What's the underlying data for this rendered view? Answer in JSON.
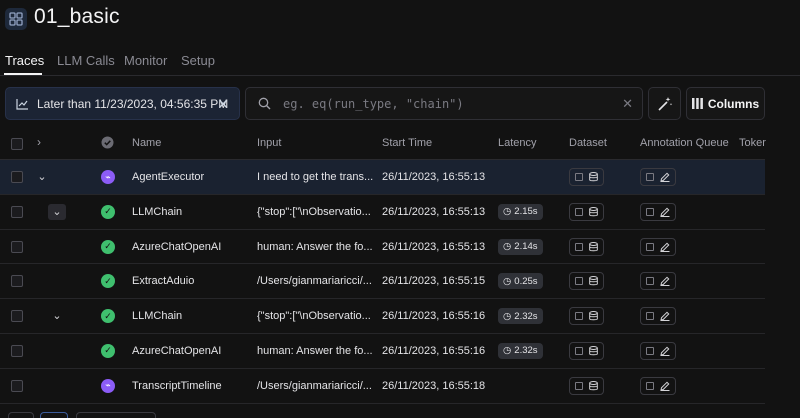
{
  "project": {
    "title": "01_basic",
    "icon": "grid-icon"
  },
  "tabs": [
    {
      "label": "Traces",
      "active": true
    },
    {
      "label": "LLM Calls",
      "active": false
    },
    {
      "label": "Monitor",
      "active": false
    },
    {
      "label": "Setup",
      "active": false
    }
  ],
  "toolbar": {
    "filter_label": "Later than 11/23/2023, 04:56:35 PM",
    "search_placeholder": "eg. eq(run_type, \"chain\")",
    "columns_label": "Columns"
  },
  "table": {
    "headers": {
      "name": "Name",
      "input": "Input",
      "start_time": "Start Time",
      "latency": "Latency",
      "dataset": "Dataset",
      "annotation_queue": "Annotation Queue",
      "tokens": "Toker"
    },
    "rows": [
      {
        "name": "AgentExecutor",
        "input": "I need to get the trans...",
        "start_time": "26/11/2023, 16:55:13",
        "latency": "",
        "status": "running",
        "selected": true
      },
      {
        "name": "LLMChain",
        "input": "{\"stop\":[\"\\nObservatio...",
        "start_time": "26/11/2023, 16:55:13",
        "latency": "2.15s",
        "status": "success",
        "selected": false
      },
      {
        "name": "AzureChatOpenAI",
        "input": "human: Answer the fo...",
        "start_time": "26/11/2023, 16:55:13",
        "latency": "2.14s",
        "status": "success",
        "selected": false
      },
      {
        "name": "ExtractAduio",
        "input": "/Users/gianmariaricci/...",
        "start_time": "26/11/2023, 16:55:15",
        "latency": "0.25s",
        "status": "success",
        "selected": false
      },
      {
        "name": "LLMChain",
        "input": "{\"stop\":[\"\\nObservatio...",
        "start_time": "26/11/2023, 16:55:16",
        "latency": "2.32s",
        "status": "success",
        "selected": false
      },
      {
        "name": "AzureChatOpenAI",
        "input": "human: Answer the fo...",
        "start_time": "26/11/2023, 16:55:16",
        "latency": "2.32s",
        "status": "success",
        "selected": false
      },
      {
        "name": "TranscriptTimeline",
        "input": "/Users/gianmariaricci/...",
        "start_time": "26/11/2023, 16:55:18",
        "latency": "",
        "status": "running",
        "selected": false
      }
    ]
  },
  "colors": {
    "success": "#3fbf6e",
    "running": "#8b5cf6",
    "accent_bg": "#1c2434"
  }
}
